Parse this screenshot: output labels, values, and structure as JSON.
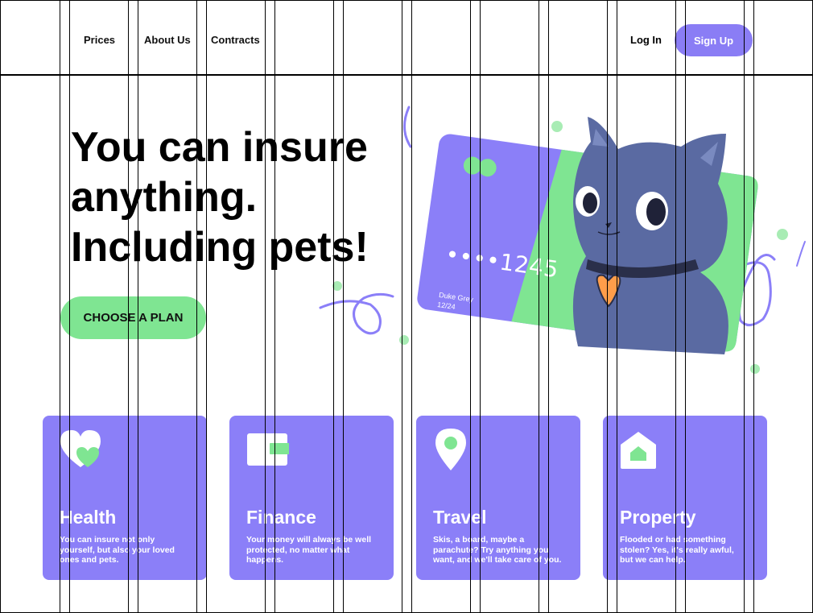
{
  "nav": {
    "links": [
      "Prices",
      "About Us",
      "Contracts"
    ],
    "login_label": "Log In",
    "signup_label": "Sign Up"
  },
  "hero": {
    "headline": [
      "You can insure",
      "anything.",
      "Including pets!"
    ],
    "cta_label": "CHOOSE A PLAN",
    "card": {
      "number": "••••1245",
      "name": "Duke Grey",
      "expiry": "12/24"
    }
  },
  "categories": [
    {
      "title": "Health",
      "description": "You can insure not only yourself, but also your loved ones and pets.",
      "icon": "heart-icon"
    },
    {
      "title": "Finance",
      "description": "Your money will always be well protected, no matter what happens.",
      "icon": "wallet-icon"
    },
    {
      "title": "Travel",
      "description": "Skis, a board, maybe a parachute? Try anything you want, and we'll take care of you.",
      "icon": "location-pin-icon"
    },
    {
      "title": "Property",
      "description": "Flooded or had something stolen? Yes, it's really awful, but we can help.",
      "icon": "home-icon"
    }
  ],
  "colors": {
    "primary": "#8b7ff8",
    "accent": "#7fe592",
    "text": "#000000"
  }
}
